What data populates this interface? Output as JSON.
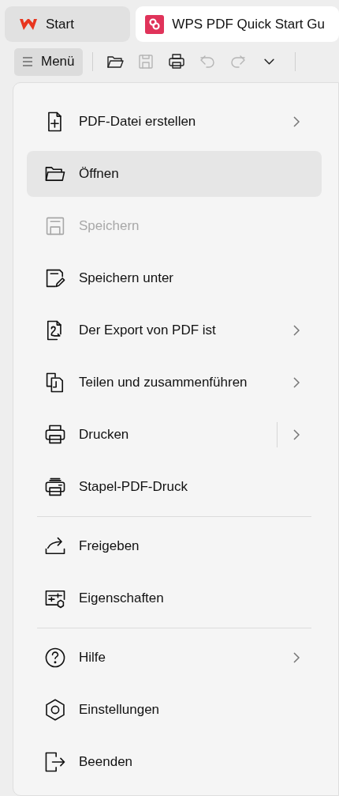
{
  "tabs": [
    {
      "label": "Start",
      "selected": false
    },
    {
      "label": "WPS PDF Quick Start Gu",
      "selected": true
    }
  ],
  "toolbar": {
    "menu_label": "Menü",
    "buttons": [
      {
        "disabled": false
      },
      {
        "disabled": true
      },
      {
        "disabled": false
      },
      {
        "disabled": true
      },
      {
        "disabled": true
      },
      {
        "disabled": false
      }
    ]
  },
  "menu": [
    {
      "kind": "item",
      "label": "PDF-Datei erstellen",
      "selected": false,
      "disabled": false,
      "submenu": true,
      "split": false
    },
    {
      "kind": "item",
      "label": "Öffnen",
      "selected": true,
      "disabled": false,
      "submenu": false,
      "split": false
    },
    {
      "kind": "item",
      "label": "Speichern",
      "selected": false,
      "disabled": true,
      "submenu": false,
      "split": false
    },
    {
      "kind": "item",
      "label": "Speichern unter",
      "selected": false,
      "disabled": false,
      "submenu": false,
      "split": false
    },
    {
      "kind": "item",
      "label": "Der Export von PDF ist",
      "selected": false,
      "disabled": false,
      "submenu": true,
      "split": false
    },
    {
      "kind": "item",
      "label": "Teilen und zusammenführen",
      "selected": false,
      "disabled": false,
      "submenu": true,
      "split": false
    },
    {
      "kind": "item",
      "label": "Drucken",
      "selected": false,
      "disabled": false,
      "submenu": true,
      "split": true
    },
    {
      "kind": "item",
      "label": "Stapel-PDF-Druck",
      "selected": false,
      "disabled": false,
      "submenu": false,
      "split": false
    },
    {
      "kind": "divider"
    },
    {
      "kind": "item",
      "label": "Freigeben",
      "selected": false,
      "disabled": false,
      "submenu": false,
      "split": false
    },
    {
      "kind": "item",
      "label": "Eigenschaften",
      "selected": false,
      "disabled": false,
      "submenu": false,
      "split": false
    },
    {
      "kind": "divider"
    },
    {
      "kind": "item",
      "label": "Hilfe",
      "selected": false,
      "disabled": false,
      "submenu": true,
      "split": false
    },
    {
      "kind": "item",
      "label": "Einstellungen",
      "selected": false,
      "disabled": false,
      "submenu": false,
      "split": false
    },
    {
      "kind": "item",
      "label": "Beenden",
      "selected": false,
      "disabled": false,
      "submenu": false,
      "split": false
    }
  ]
}
